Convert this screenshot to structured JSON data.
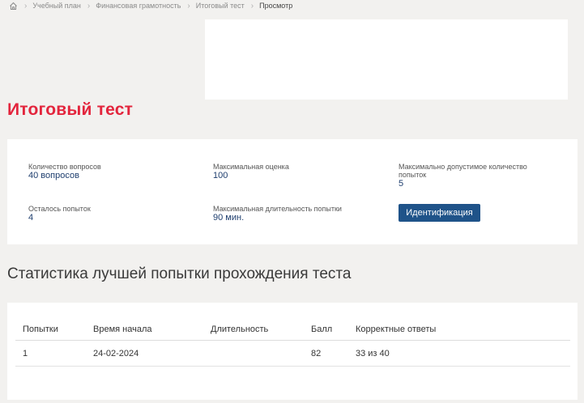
{
  "breadcrumb": {
    "items": [
      "Учебный план",
      "Финансовая грамотность",
      "Итоговый тест",
      "Просмотр"
    ]
  },
  "page": {
    "title": "Итоговый тест"
  },
  "info": {
    "questions_label": "Количество вопросов",
    "questions_value": "40 вопросов",
    "max_score_label": "Максимальная оценка",
    "max_score_value": "100",
    "max_attempts_label": "Максимально допустимое количество попыток",
    "max_attempts_value": "5",
    "attempts_left_label": "Осталось попыток",
    "attempts_left_value": "4",
    "max_duration_label": "Максимальная длительность попытки",
    "max_duration_value": "90 мин.",
    "identify_button": "Идентификация"
  },
  "stats": {
    "title": "Статистика лучшей попытки прохождения теста",
    "columns": [
      "Попытки",
      "Время начала",
      "Длительность",
      "Балл",
      "Корректные ответы"
    ],
    "rows": [
      [
        "1",
        "24-02-2024",
        "",
        "82",
        "33 из 40"
      ]
    ]
  },
  "colors": {
    "title_red": "#e3253d",
    "button_blue": "#1f5389",
    "value_blue": "#1e3e6e",
    "background": "#f2f1ef"
  },
  "icons": {
    "home": "home-icon",
    "separator": "chevron-right-icon"
  }
}
